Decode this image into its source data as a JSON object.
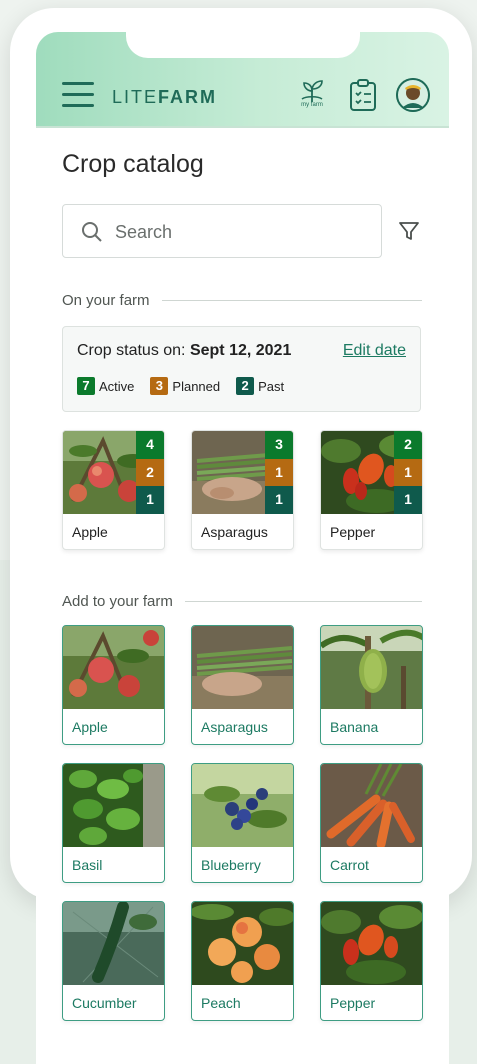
{
  "app": {
    "logo_light": "LITE",
    "logo_bold": "FARM",
    "myfarm_label": "my farm"
  },
  "page": {
    "title": "Crop catalog"
  },
  "search": {
    "placeholder": "Search"
  },
  "sections": {
    "on_farm": "On your farm",
    "add_farm": "Add to your farm"
  },
  "status": {
    "prefix": "Crop status on: ",
    "date": "Sept 12, 2021",
    "edit_label": "Edit date",
    "active_count": "7",
    "active_label": "Active",
    "planned_count": "3",
    "planned_label": "Planned",
    "past_count": "2",
    "past_label": "Past"
  },
  "colors": {
    "active": "#0b7a2c",
    "planned": "#b56a12",
    "past": "#0f5a4c",
    "brand": "#1f6b58"
  },
  "farm_crops": [
    {
      "name": "Apple",
      "active": "4",
      "planned": "2",
      "past": "1"
    },
    {
      "name": "Asparagus",
      "active": "3",
      "planned": "1",
      "past": "1"
    },
    {
      "name": "Pepper",
      "active": "2",
      "planned": "1",
      "past": "1"
    }
  ],
  "add_crops": [
    {
      "name": "Apple"
    },
    {
      "name": "Asparagus"
    },
    {
      "name": "Banana"
    },
    {
      "name": "Basil"
    },
    {
      "name": "Blueberry"
    },
    {
      "name": "Carrot"
    },
    {
      "name": "Cucumber"
    },
    {
      "name": "Peach"
    },
    {
      "name": "Pepper"
    }
  ]
}
